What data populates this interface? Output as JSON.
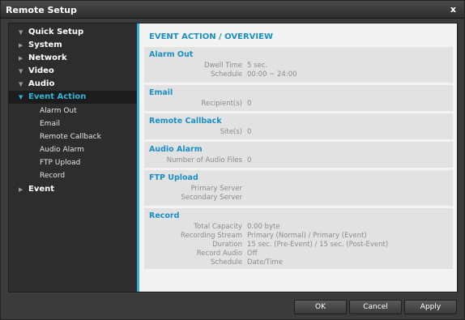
{
  "window": {
    "title": "Remote Setup",
    "close_glyph": "x"
  },
  "sidebar": {
    "items": [
      {
        "label": "Quick Setup",
        "arrow": "▼"
      },
      {
        "label": "System",
        "arrow": "▶"
      },
      {
        "label": "Network",
        "arrow": "▶"
      },
      {
        "label": "Video",
        "arrow": "▼"
      },
      {
        "label": "Audio",
        "arrow": "▼"
      },
      {
        "label": "Event Action",
        "arrow": "▼",
        "selected": true
      },
      {
        "label": "Event",
        "arrow": "▶"
      }
    ],
    "subitems": [
      "Alarm Out",
      "Email",
      "Remote Callback",
      "Audio Alarm",
      "FTP Upload",
      "Record"
    ]
  },
  "content": {
    "title": "EVENT ACTION / OVERVIEW",
    "sections": [
      {
        "title": "Alarm Out",
        "rows": [
          {
            "k": "Dwell Time",
            "v": "5 sec."
          },
          {
            "k": "Schedule",
            "v": "00:00 ~ 24:00"
          }
        ]
      },
      {
        "title": "Email",
        "rows": [
          {
            "k": "Recipient(s)",
            "v": "0"
          }
        ]
      },
      {
        "title": "Remote Callback",
        "rows": [
          {
            "k": "Site(s)",
            "v": "0"
          }
        ]
      },
      {
        "title": "Audio Alarm",
        "rows": [
          {
            "k": "Number of Audio Files",
            "v": "0"
          }
        ]
      },
      {
        "title": "FTP Upload",
        "rows": [
          {
            "k": "Primary Server",
            "v": ""
          },
          {
            "k": "Secondary Server",
            "v": ""
          }
        ]
      },
      {
        "title": "Record",
        "rows": [
          {
            "k": "Total Capacity",
            "v": "0.00 byte"
          },
          {
            "k": "Recording Stream",
            "v": "Primary (Normal) / Primary (Event)"
          },
          {
            "k": "Duration",
            "v": "15 sec. (Pre-Event) / 15 sec. (Post-Event)"
          },
          {
            "k": "Record Audio",
            "v": "Off"
          },
          {
            "k": "Schedule",
            "v": "Date/Time"
          }
        ]
      }
    ]
  },
  "buttons": {
    "ok": "OK",
    "cancel": "Cancel",
    "apply": "Apply"
  }
}
